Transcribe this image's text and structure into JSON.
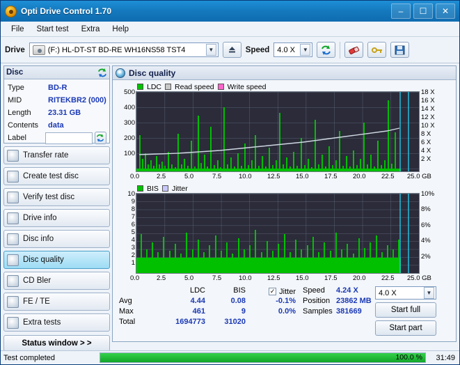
{
  "window": {
    "title": "Opti Drive Control 1.70",
    "minimize": "–",
    "maximize": "☐",
    "close": "✕"
  },
  "menu": [
    "File",
    "Start test",
    "Extra",
    "Help"
  ],
  "drivebar": {
    "drive_label": "Drive",
    "drive_value": "(F:)  HL-DT-ST BD-RE  WH16NS58 TST4",
    "eject_icon": "eject-icon",
    "speed_label": "Speed",
    "speed_value": "4.0 X",
    "refresh_icon": "refresh-icon",
    "erase_icon": "eraser-icon",
    "settings_icon": "key-icon",
    "save_icon": "save-icon"
  },
  "disc_panel": {
    "title": "Disc",
    "refresh_icon": "refresh-icon",
    "rows": [
      {
        "key": "Type",
        "value": "BD-R"
      },
      {
        "key": "MID",
        "value": "RITEKBR2 (000)"
      },
      {
        "key": "Length",
        "value": "23.31 GB"
      },
      {
        "key": "Contents",
        "value": "data"
      },
      {
        "key": "Label",
        "value": ""
      }
    ],
    "label_button_icon": "refresh-label-icon"
  },
  "sidebar": {
    "items": [
      {
        "label": "Transfer rate",
        "icon": "transfer-rate-icon",
        "active": false
      },
      {
        "label": "Create test disc",
        "icon": "create-disc-icon",
        "active": false
      },
      {
        "label": "Verify test disc",
        "icon": "verify-disc-icon",
        "active": false
      },
      {
        "label": "Drive info",
        "icon": "drive-info-icon",
        "active": false
      },
      {
        "label": "Disc info",
        "icon": "disc-info-icon",
        "active": false
      },
      {
        "label": "Disc quality",
        "icon": "disc-quality-icon",
        "active": true
      },
      {
        "label": "CD Bler",
        "icon": "cd-bler-icon",
        "active": false
      },
      {
        "label": "FE / TE",
        "icon": "fe-te-icon",
        "active": false
      },
      {
        "label": "Extra tests",
        "icon": "extra-tests-icon",
        "active": false
      }
    ],
    "status_window": "Status window > >"
  },
  "main": {
    "title": "Disc quality",
    "icon": "disc-icon"
  },
  "chart_data": [
    {
      "type": "line",
      "name": "top-graph",
      "legend": [
        {
          "label": "LDC",
          "color": "#00c000"
        },
        {
          "label": "Read speed",
          "color": "#c8c8c8"
        },
        {
          "label": "Write speed",
          "color": "#ff66cc"
        }
      ],
      "xlabel": "GB",
      "x_ticks": [
        "0.0",
        "2.5",
        "5.0",
        "7.5",
        "10.0",
        "12.5",
        "15.0",
        "17.5",
        "20.0",
        "22.5",
        "25.0 GB"
      ],
      "xlim": [
        0,
        25.0
      ],
      "ylabel_left": "LDC",
      "y_ticks_left": [
        "500",
        "400",
        "300",
        "200",
        "100"
      ],
      "ylim_left": [
        0,
        550
      ],
      "ylabel_right": "X",
      "y_ticks_right": [
        "18 X",
        "16 X",
        "14 X",
        "12 X",
        "10 X",
        "8 X",
        "6 X",
        "4 X",
        "2 X"
      ],
      "ylim_right": [
        0,
        19
      ],
      "grid": true,
      "series": [
        {
          "name": "LDC",
          "color": "#00c000",
          "avg": 4.44,
          "max": 461,
          "total": 1694773
        },
        {
          "name": "Read speed",
          "color": "#c8d2dc",
          "value_at_end": 4.24
        }
      ]
    },
    {
      "type": "line",
      "name": "bottom-graph",
      "legend": [
        {
          "label": "BIS",
          "color": "#00c000"
        },
        {
          "label": "Jitter",
          "color": "#c8c8ff"
        }
      ],
      "xlabel": "GB",
      "x_ticks": [
        "0.0",
        "2.5",
        "5.0",
        "7.5",
        "10.0",
        "12.5",
        "15.0",
        "17.5",
        "20.0",
        "22.5",
        "25.0 GB"
      ],
      "xlim": [
        0,
        25.0
      ],
      "ylabel_left": "BIS",
      "y_ticks_left": [
        "10",
        "9",
        "8",
        "7",
        "6",
        "5",
        "4",
        "3",
        "2",
        "1"
      ],
      "ylim_left": [
        0,
        10
      ],
      "ylabel_right": "Jitter %",
      "y_ticks_right": [
        "10%",
        "8%",
        "6%",
        "4%",
        "2%"
      ],
      "ylim_right": [
        0,
        11
      ],
      "grid": true,
      "series": [
        {
          "name": "BIS",
          "color": "#00c000",
          "avg": 0.08,
          "max": 9,
          "total": 31020
        }
      ]
    }
  ],
  "stats": {
    "columns": [
      "LDC",
      "BIS"
    ],
    "rows": [
      {
        "label": "Avg",
        "ldc": "4.44",
        "bis": "0.08"
      },
      {
        "label": "Max",
        "ldc": "461",
        "bis": "9"
      },
      {
        "label": "Total",
        "ldc": "1694773",
        "bis": "31020"
      }
    ],
    "jitter": {
      "checkbox_label": "Jitter",
      "checked": true,
      "avg": "-0.1%",
      "max": "0.0%"
    },
    "right": {
      "speed_label": "Speed",
      "speed_value": "4.24 X",
      "position_label": "Position",
      "position_value": "23862 MB",
      "samples_label": "Samples",
      "samples_value": "381669",
      "speed_select": "4.0 X",
      "start_full": "Start full",
      "start_part": "Start part"
    }
  },
  "statusbar": {
    "message": "Test completed",
    "progress_text": "100.0 %",
    "progress_value": 100,
    "time": "31:49"
  }
}
